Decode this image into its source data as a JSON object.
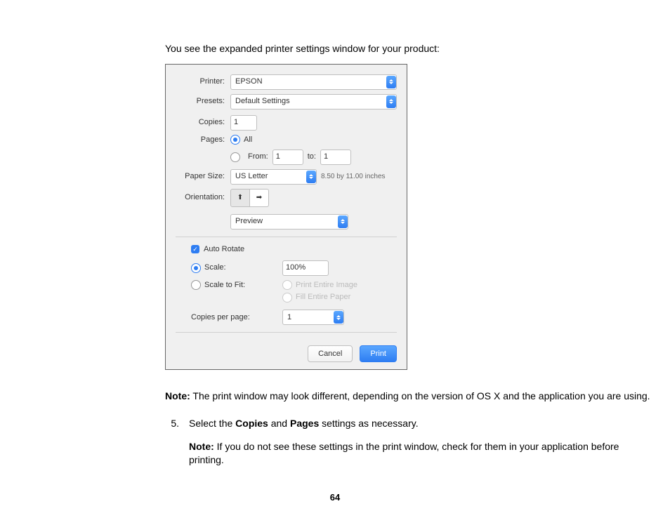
{
  "intro": "You see the expanded printer settings window for your product:",
  "dialog": {
    "labels": {
      "printer": "Printer:",
      "presets": "Presets:",
      "copies": "Copies:",
      "pages": "Pages:",
      "from": "From:",
      "to": "to:",
      "paperSize": "Paper Size:",
      "orientation": "Orientation:",
      "autoRotate": "Auto Rotate",
      "scale": "Scale:",
      "scaleToFit": "Scale to Fit:",
      "printEntire": "Print Entire Image",
      "fillPaper": "Fill Entire Paper",
      "copiesPerPage": "Copies per page:"
    },
    "values": {
      "printer": "EPSON",
      "presets": "Default Settings",
      "copies": "1",
      "pagesAll": "All",
      "from": "1",
      "to": "1",
      "paperSize": "US Letter",
      "paperDim": "8.50 by 11.00 inches",
      "section": "Preview",
      "scale": "100%",
      "copiesPerPage": "1"
    },
    "buttons": {
      "cancel": "Cancel",
      "print": "Print"
    }
  },
  "noteLabel": "Note:",
  "note1": " The print window may look different, depending on the version of OS X and the application you are using.",
  "step5num": "5.",
  "step5a": "Select the ",
  "step5b": "Copies",
  "step5c": " and ",
  "step5d": "Pages",
  "step5e": " settings as necessary.",
  "note2": " If you do not see these settings in the print window, check for them in your application before printing.",
  "pageNumber": "64"
}
